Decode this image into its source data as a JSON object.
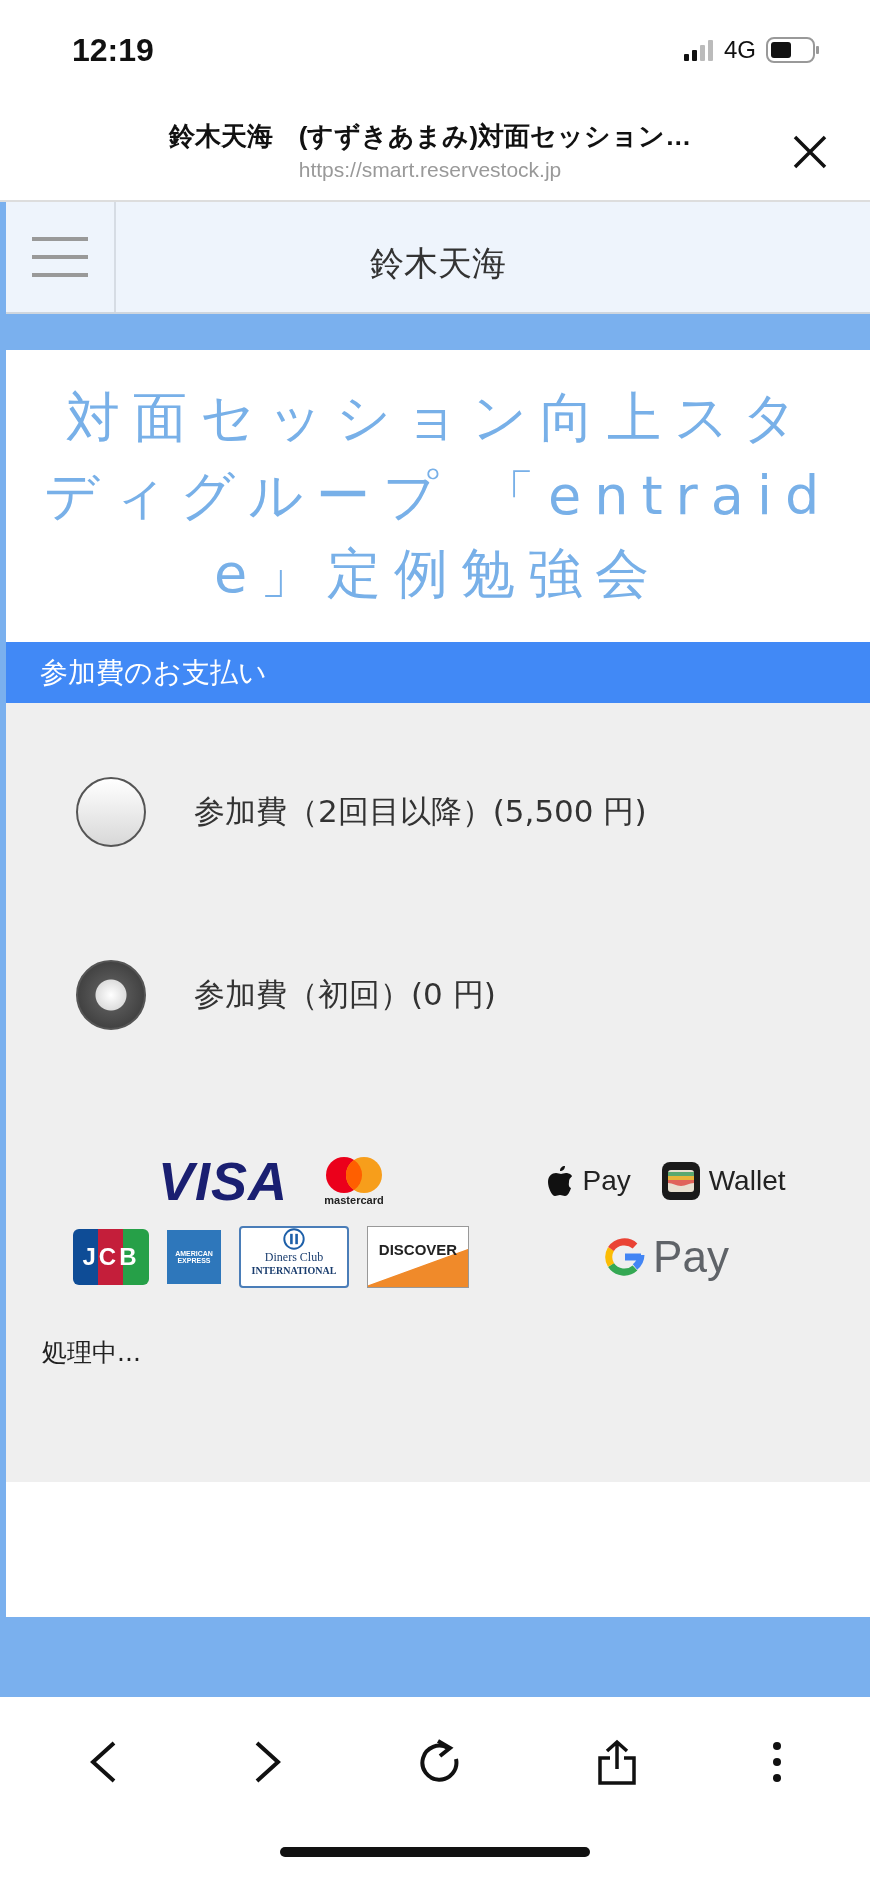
{
  "status_bar": {
    "time": "12:19",
    "network": "4G"
  },
  "browser": {
    "title": "鈴木天海　(すずきあまみ)対面セッション…",
    "url": "https://smart.reservestock.jp"
  },
  "header": {
    "title": "鈴木天海"
  },
  "event_title": "対面セッション向上スタディグループ 「entraide」定例勉強会",
  "payment": {
    "heading": "参加費のお支払い",
    "options": [
      {
        "label": "参加費（2回目以降）(5,500 円)",
        "selected": false
      },
      {
        "label": "参加費（初回）(0 円)",
        "selected": true
      }
    ],
    "logo_rows": [
      {
        "left": [
          {
            "kind": "visa",
            "lines": [
              "VISA"
            ]
          },
          {
            "kind": "mastercard",
            "lines": [
              "mastercard"
            ]
          }
        ],
        "right": [
          {
            "kind": "applepay",
            "lines": [
              "Pay"
            ]
          },
          {
            "kind": "wallet",
            "lines": [
              "Wallet"
            ]
          }
        ]
      },
      {
        "left": [
          {
            "kind": "jcb",
            "lines": [
              "JCB"
            ]
          },
          {
            "kind": "amex",
            "lines": [
              "AMERICAN",
              "EXPRESS"
            ]
          },
          {
            "kind": "diners",
            "lines": [
              "Diners Club",
              "INTERNATIONAL"
            ]
          },
          {
            "kind": "discover",
            "lines": [
              "DISCOVER"
            ]
          }
        ],
        "right": [
          {
            "kind": "gpay",
            "lines": [
              "Pay"
            ]
          }
        ]
      }
    ],
    "status": "処理中..."
  }
}
